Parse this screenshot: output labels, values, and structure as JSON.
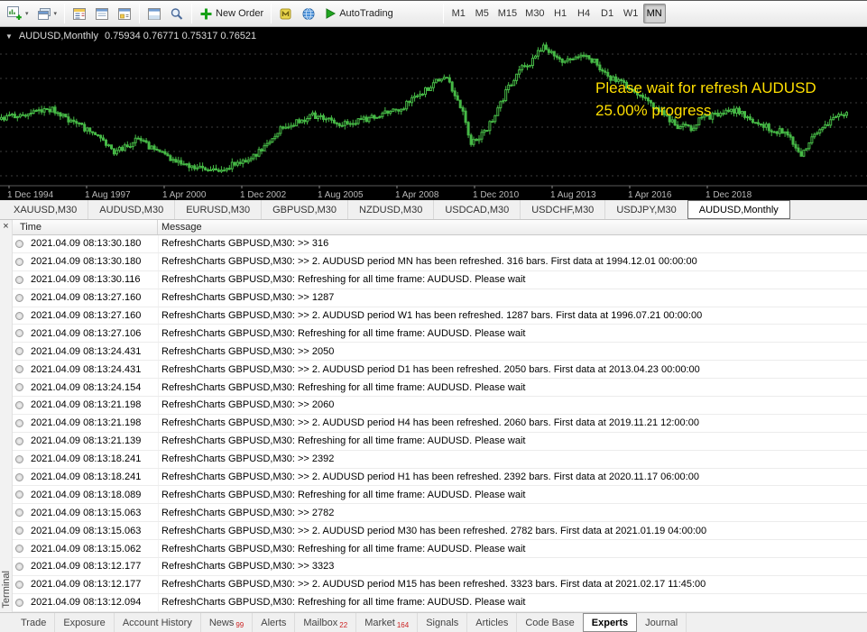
{
  "toolbar": {
    "new_order_label": "New Order",
    "autotrading_label": "AutoTrading",
    "timeframes": [
      {
        "label": "M1",
        "active": false
      },
      {
        "label": "M5",
        "active": false
      },
      {
        "label": "M15",
        "active": false
      },
      {
        "label": "M30",
        "active": false
      },
      {
        "label": "H1",
        "active": false
      },
      {
        "label": "H4",
        "active": false
      },
      {
        "label": "D1",
        "active": false
      },
      {
        "label": "W1",
        "active": false
      },
      {
        "label": "MN",
        "active": true
      }
    ]
  },
  "chart": {
    "symbol_title": "AUDUSD,Monthly",
    "ohlc": "0.75934 0.76771 0.75317 0.76521",
    "overlay": {
      "line1": "Please wait for refresh AUDUSD",
      "line2": "25.00% progress"
    },
    "x_axis_labels": [
      "1 Dec 1994",
      "1 Aug 1997",
      "1 Apr 2000",
      "1 Dec 2002",
      "1 Aug 2005",
      "1 Apr 2008",
      "1 Dec 2010",
      "1 Aug 2013",
      "1 Apr 2016",
      "1 Dec 2018"
    ],
    "bar_count": 316,
    "price_range": [
      0.45,
      1.14
    ],
    "price_path": [
      [
        0.0,
        0.745
      ],
      [
        0.03,
        0.77
      ],
      [
        0.06,
        0.79
      ],
      [
        0.1,
        0.7
      ],
      [
        0.135,
        0.585
      ],
      [
        0.16,
        0.645
      ],
      [
        0.2,
        0.56
      ],
      [
        0.245,
        0.49
      ],
      [
        0.27,
        0.52
      ],
      [
        0.3,
        0.565
      ],
      [
        0.33,
        0.7
      ],
      [
        0.37,
        0.765
      ],
      [
        0.4,
        0.72
      ],
      [
        0.44,
        0.755
      ],
      [
        0.47,
        0.79
      ],
      [
        0.5,
        0.88
      ],
      [
        0.525,
        0.96
      ],
      [
        0.545,
        0.79
      ],
      [
        0.555,
        0.625
      ],
      [
        0.575,
        0.7
      ],
      [
        0.6,
        0.9
      ],
      [
        0.615,
        0.99
      ],
      [
        0.625,
        1.02
      ],
      [
        0.64,
        1.095
      ],
      [
        0.66,
        1.03
      ],
      [
        0.68,
        1.05
      ],
      [
        0.7,
        1.035
      ],
      [
        0.715,
        0.96
      ],
      [
        0.73,
        0.925
      ],
      [
        0.755,
        0.87
      ],
      [
        0.78,
        0.78
      ],
      [
        0.8,
        0.715
      ],
      [
        0.815,
        0.7
      ],
      [
        0.83,
        0.755
      ],
      [
        0.85,
        0.765
      ],
      [
        0.87,
        0.795
      ],
      [
        0.89,
        0.73
      ],
      [
        0.91,
        0.7
      ],
      [
        0.93,
        0.675
      ],
      [
        0.945,
        0.57
      ],
      [
        0.96,
        0.655
      ],
      [
        0.975,
        0.715
      ],
      [
        0.99,
        0.755
      ],
      [
        1.0,
        0.765
      ]
    ],
    "colors": {
      "background": "#000000",
      "candle": "#46b946",
      "overlay_text": "#ffdf00",
      "axis_text": "#b8b8b8",
      "grid": "#3d3d3d"
    }
  },
  "chart_tabs": [
    {
      "label": "XAUUSD,M30",
      "active": false
    },
    {
      "label": "AUDUSD,M30",
      "active": false
    },
    {
      "label": "EURUSD,M30",
      "active": false
    },
    {
      "label": "GBPUSD,M30",
      "active": false
    },
    {
      "label": "NZDUSD,M30",
      "active": false
    },
    {
      "label": "USDCAD,M30",
      "active": false
    },
    {
      "label": "USDCHF,M30",
      "active": false
    },
    {
      "label": "USDJPY,M30",
      "active": false
    },
    {
      "label": "AUDUSD,Monthly",
      "active": true
    }
  ],
  "terminal": {
    "close_label": "×",
    "side_label": "Terminal",
    "columns": [
      "Time",
      "Message"
    ],
    "rows": [
      {
        "time": "2021.04.09 08:13:30.180",
        "message": "RefreshCharts GBPUSD,M30: >> 316"
      },
      {
        "time": "2021.04.09 08:13:30.180",
        "message": "RefreshCharts GBPUSD,M30: >> 2. AUDUSD period MN has been refreshed. 316 bars. First data at 1994.12.01 00:00:00"
      },
      {
        "time": "2021.04.09 08:13:30.116",
        "message": "RefreshCharts GBPUSD,M30: Refreshing for all time frame: AUDUSD. Please wait"
      },
      {
        "time": "2021.04.09 08:13:27.160",
        "message": "RefreshCharts GBPUSD,M30: >> 1287"
      },
      {
        "time": "2021.04.09 08:13:27.160",
        "message": "RefreshCharts GBPUSD,M30: >> 2. AUDUSD period W1 has been refreshed. 1287 bars. First data at 1996.07.21 00:00:00"
      },
      {
        "time": "2021.04.09 08:13:27.106",
        "message": "RefreshCharts GBPUSD,M30: Refreshing for all time frame: AUDUSD. Please wait"
      },
      {
        "time": "2021.04.09 08:13:24.431",
        "message": "RefreshCharts GBPUSD,M30: >> 2050"
      },
      {
        "time": "2021.04.09 08:13:24.431",
        "message": "RefreshCharts GBPUSD,M30: >> 2. AUDUSD period D1 has been refreshed. 2050 bars. First data at 2013.04.23 00:00:00"
      },
      {
        "time": "2021.04.09 08:13:24.154",
        "message": "RefreshCharts GBPUSD,M30: Refreshing for all time frame: AUDUSD. Please wait"
      },
      {
        "time": "2021.04.09 08:13:21.198",
        "message": "RefreshCharts GBPUSD,M30: >> 2060"
      },
      {
        "time": "2021.04.09 08:13:21.198",
        "message": "RefreshCharts GBPUSD,M30: >> 2. AUDUSD period H4 has been refreshed. 2060 bars. First data at 2019.11.21 12:00:00"
      },
      {
        "time": "2021.04.09 08:13:21.139",
        "message": "RefreshCharts GBPUSD,M30: Refreshing for all time frame: AUDUSD. Please wait"
      },
      {
        "time": "2021.04.09 08:13:18.241",
        "message": "RefreshCharts GBPUSD,M30: >> 2392"
      },
      {
        "time": "2021.04.09 08:13:18.241",
        "message": "RefreshCharts GBPUSD,M30: >> 2. AUDUSD period H1 has been refreshed. 2392 bars. First data at 2020.11.17 06:00:00"
      },
      {
        "time": "2021.04.09 08:13:18.089",
        "message": "RefreshCharts GBPUSD,M30: Refreshing for all time frame: AUDUSD. Please wait"
      },
      {
        "time": "2021.04.09 08:13:15.063",
        "message": "RefreshCharts GBPUSD,M30: >> 2782"
      },
      {
        "time": "2021.04.09 08:13:15.063",
        "message": "RefreshCharts GBPUSD,M30: >> 2. AUDUSD period M30 has been refreshed. 2782 bars. First data at 2021.01.19 04:00:00"
      },
      {
        "time": "2021.04.09 08:13:15.062",
        "message": "RefreshCharts GBPUSD,M30: Refreshing for all time frame: AUDUSD. Please wait"
      },
      {
        "time": "2021.04.09 08:13:12.177",
        "message": "RefreshCharts GBPUSD,M30: >> 3323"
      },
      {
        "time": "2021.04.09 08:13:12.177",
        "message": "RefreshCharts GBPUSD,M30: >> 2. AUDUSD period M15 has been refreshed. 3323 bars. First data at 2021.02.17 11:45:00"
      },
      {
        "time": "2021.04.09 08:13:12.094",
        "message": "RefreshCharts GBPUSD,M30: Refreshing for all time frame: AUDUSD. Please wait"
      }
    ]
  },
  "bottom_tabs": [
    {
      "label": "Trade"
    },
    {
      "label": "Exposure"
    },
    {
      "label": "Account History"
    },
    {
      "label": "News",
      "badge": "99"
    },
    {
      "label": "Alerts"
    },
    {
      "label": "Mailbox",
      "badge": "22"
    },
    {
      "label": "Market",
      "badge": "164"
    },
    {
      "label": "Signals"
    },
    {
      "label": "Articles"
    },
    {
      "label": "Code Base"
    },
    {
      "label": "Experts",
      "active": true
    },
    {
      "label": "Journal"
    }
  ]
}
